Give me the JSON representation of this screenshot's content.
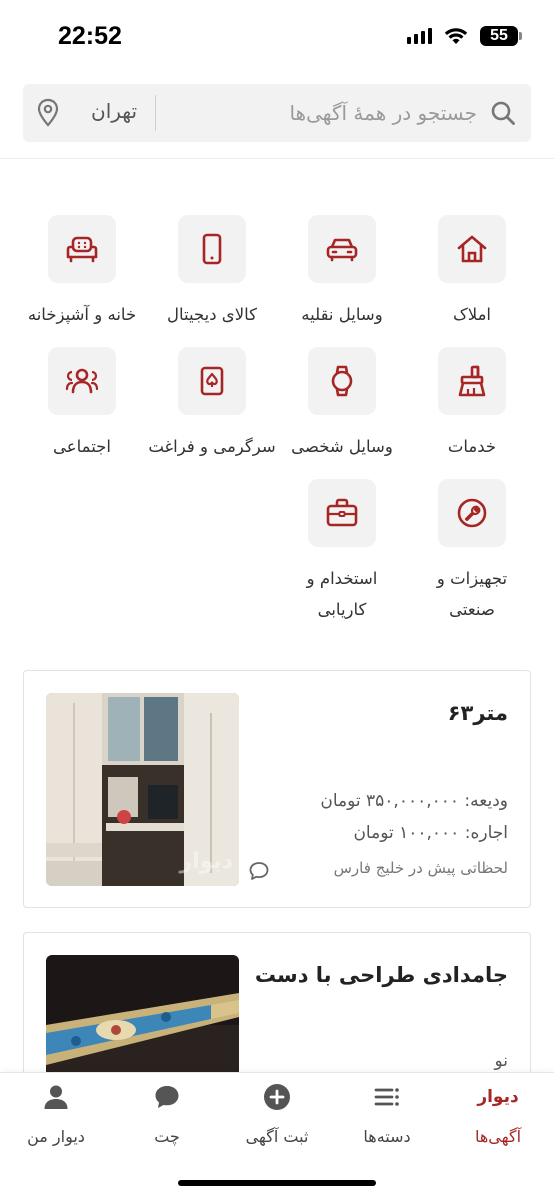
{
  "status_bar": {
    "time": "22:52",
    "battery": "55"
  },
  "search": {
    "placeholder": "جستجو در همهٔ آگهی‌ها",
    "city": "تهران"
  },
  "categories": [
    {
      "label": "املاک",
      "icon": "home-icon"
    },
    {
      "label": "وسایل نقلیه",
      "icon": "car-icon"
    },
    {
      "label": "کالای دیجیتال",
      "icon": "mobile-icon"
    },
    {
      "label": "خانه و آشپزخانه",
      "icon": "armchair-icon"
    },
    {
      "label": "خدمات",
      "icon": "brush-icon"
    },
    {
      "label": "وسایل شخصی",
      "icon": "watch-icon"
    },
    {
      "label": "سرگرمی و فراغت",
      "icon": "cards-icon"
    },
    {
      "label": "اجتماعی",
      "icon": "people-icon"
    },
    {
      "label": "تجهیزات و صنعتی",
      "icon": "wrench-icon"
    },
    {
      "label": "استخدام و کاریابی",
      "icon": "briefcase-icon"
    }
  ],
  "ads": [
    {
      "title": "متر۶۳",
      "deposit": "ودیعه: ۳۵۰,۰۰۰,۰۰۰ تومان",
      "rent": "اجاره: ۱۰۰,۰۰۰ تومان",
      "location": "لحظاتی پیش در خلیج فارس",
      "watermark": "دیوار"
    },
    {
      "title": "جامدادی طراحی با دست",
      "condition": "نو"
    }
  ],
  "bottom_nav": {
    "brand": "دیوار",
    "items": [
      {
        "label": "آگهی‌ها",
        "active": true
      },
      {
        "label": "دسته‌ها"
      },
      {
        "label": "ثبت آگهی"
      },
      {
        "label": "چت"
      },
      {
        "label": "دیوار من"
      }
    ]
  },
  "colors": {
    "accent": "#a62626",
    "tile_bg": "#f2f2f2"
  }
}
